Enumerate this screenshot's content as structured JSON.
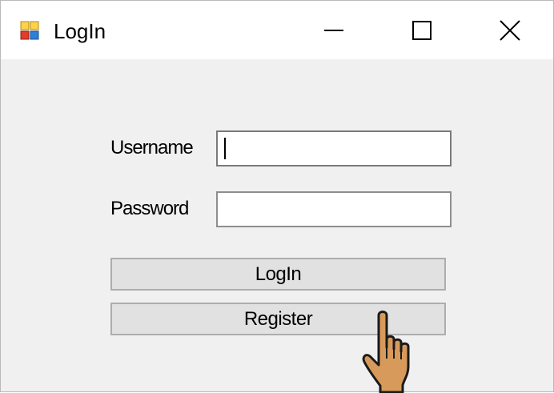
{
  "window": {
    "title": "LogIn",
    "app_icon": "winforms-app-icon",
    "controls": {
      "minimize_icon": "minimize-icon",
      "maximize_icon": "maximize-icon",
      "close_icon": "close-icon"
    }
  },
  "form": {
    "username_label": "Username",
    "username_value": "",
    "password_label": "Password",
    "password_value": "",
    "login_button": "LogIn",
    "register_button": "Register"
  },
  "cursor": {
    "type": "hand-pointer-icon"
  },
  "colors": {
    "client_bg": "#f0f0f0",
    "titlebar_bg": "#ffffff",
    "button_bg": "#e1e1e1",
    "hand_fill": "#d89a5a"
  }
}
